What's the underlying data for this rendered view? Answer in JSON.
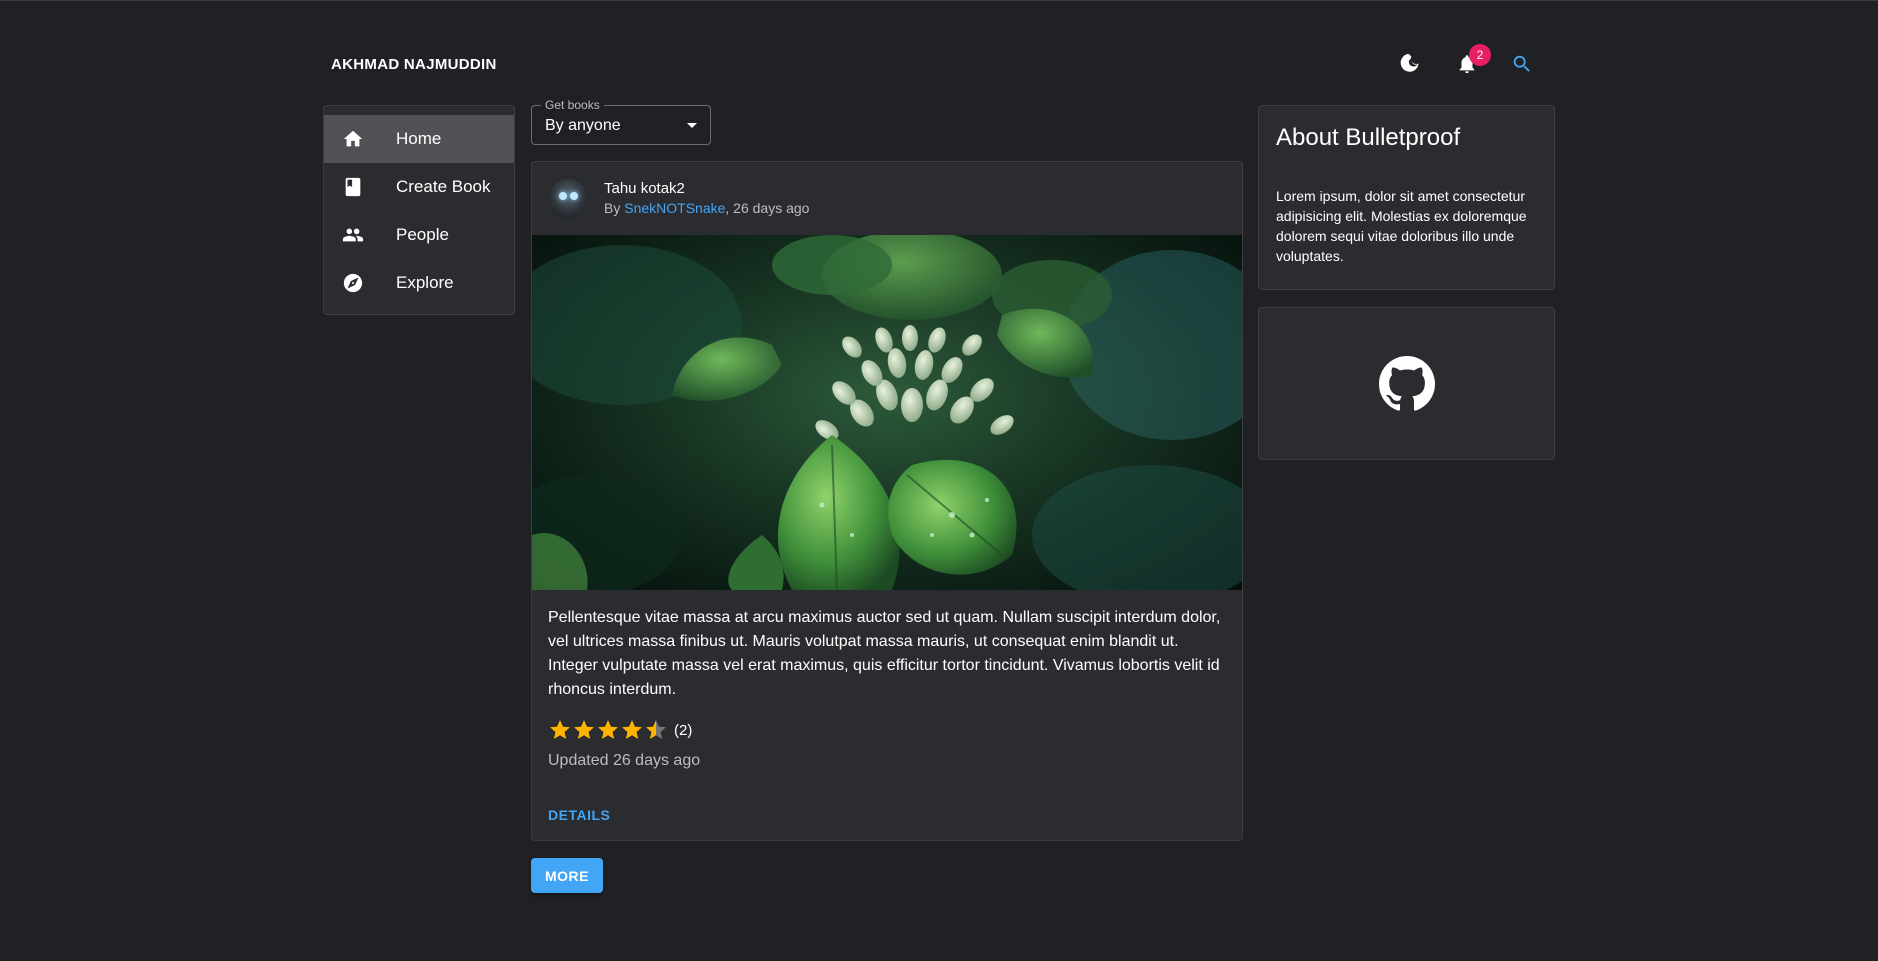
{
  "header": {
    "brand": "AKHMAD NAJMUDDIN",
    "icons": [
      "theme-toggle-icon",
      "bell-icon",
      "search-icon"
    ],
    "notification_count": "2"
  },
  "sidebar": {
    "items": [
      {
        "label": "Home",
        "icon": "home-icon",
        "active": true
      },
      {
        "label": "Create Book",
        "icon": "book-icon",
        "active": false
      },
      {
        "label": "People",
        "icon": "people-icon",
        "active": false
      },
      {
        "label": "Explore",
        "icon": "compass-icon",
        "active": false
      }
    ]
  },
  "filter": {
    "legend": "Get books",
    "value": "By anyone"
  },
  "post": {
    "title": "Tahu kotak2",
    "by_prefix": "By ",
    "author": "SnekNOTSnake",
    "time_suffix": ", 26 days ago",
    "body": "Pellentesque vitae massa at arcu maximus auctor sed ut quam. Nullam suscipit interdum dolor, vel ultrices massa finibus ut. Mauris volutpat massa mauris, ut consequat enim blandit ut. Integer vulputate massa vel erat maximus, quis efficitur tortor tincidunt. Vivamus lobortis velit id rhoncus interdum.",
    "rating": 4.5,
    "rating_max": 5,
    "rating_count": "(2)",
    "updated": "Updated 26 days ago",
    "details_label": "DETAILS"
  },
  "more_label": "MORE",
  "about": {
    "title": "About Bulletproof",
    "text": "Lorem ipsum, dolor sit amet consectetur adipisicing elit. Molestias ex doloremque dolorem sequi vitae doloribus illo unde voluptates."
  },
  "colors": {
    "accent": "#42a5f5",
    "badge": "#e91e63",
    "star": "#ffb400",
    "background": "#202124",
    "surface": "#2b2c30"
  }
}
